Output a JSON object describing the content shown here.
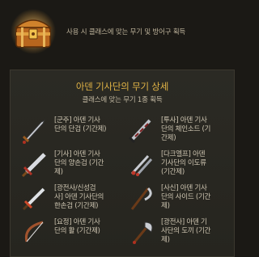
{
  "top": {
    "icon": "treasure-chest-icon",
    "description": "사용 시 클래스에 맞는 무기 및 방어구 획득"
  },
  "weapon_box": {
    "title": "아덴 기사단의 무기 상세",
    "subtitle": "클래스에 맞는 무기 1종 획득",
    "items": [
      {
        "name": "[군주] 아덴 기사\n단의 단검 (기간제)",
        "icon": "dagger-icon"
      },
      {
        "name": "[투사] 아덴 기사\n단의 체인소드 (기\n간제)",
        "icon": "chainsword-icon"
      },
      {
        "name": "[기사] 아덴 기사\n단의 양손검 (기간\n제)",
        "icon": "two-handed-sword-icon"
      },
      {
        "name": "[다크엘프] 아덴\n기사단의 이도류\n(기간제)",
        "icon": "dual-blade-icon"
      },
      {
        "name": "[광전사/신성검\n사] 아덴 기사단의\n한손검 (기간제)",
        "icon": "one-handed-sword-icon"
      },
      {
        "name": "[사신] 아덴 기사\n단의 사이드 (기간\n제)",
        "icon": "scythe-icon"
      },
      {
        "name": "[요정] 아덴 기사\n단의 활 (기간제)",
        "icon": "bow-icon"
      },
      {
        "name": "[광전사] 아덴 기\n사단의 도끼 (기간\n제)",
        "icon": "axe-icon"
      }
    ]
  }
}
